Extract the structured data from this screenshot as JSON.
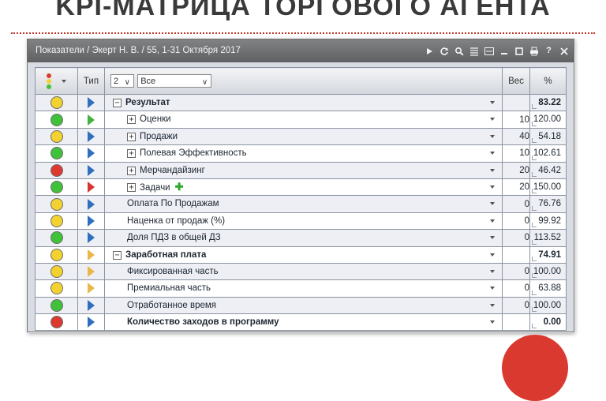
{
  "slide": {
    "title": "KPI-МАТРИЦА ТОРГОВОГО АГЕНТА"
  },
  "window": {
    "title": "Показатели / Экерт Н. В. / 55, 1-31 Октября 2017",
    "toolbar_icons": [
      "play-icon",
      "refresh-icon",
      "search-icon",
      "list-icon",
      "csv-icon",
      "minimize-icon",
      "maximize-icon",
      "print-icon",
      "help-icon",
      "close-icon"
    ]
  },
  "colors": {
    "green": "#3fc23a",
    "yellow": "#f3d22f",
    "red": "#dd3a2f",
    "flag_blue": "#2f6fbf",
    "flag_green": "#3fb33b",
    "flag_red": "#d93434",
    "flag_yellow": "#e8b84a"
  },
  "header": {
    "type_label": "Тип",
    "level_value": "2",
    "filter_value": "Все",
    "weight_label": "Вес",
    "percent_label": "%"
  },
  "rows": [
    {
      "status": "yellow",
      "flag": "blue",
      "expander": "minus",
      "indent": 0,
      "name": "Результат",
      "bold": true,
      "weight": "",
      "percent": "83.22",
      "badge": ""
    },
    {
      "status": "green",
      "flag": "green",
      "expander": "plus",
      "indent": 1,
      "name": "Оценки",
      "bold": false,
      "weight": "10",
      "percent": "120.00",
      "badge": ""
    },
    {
      "status": "yellow",
      "flag": "blue",
      "expander": "plus",
      "indent": 1,
      "name": "Продажи",
      "bold": false,
      "weight": "40",
      "percent": "54.18",
      "badge": ""
    },
    {
      "status": "green",
      "flag": "blue",
      "expander": "plus",
      "indent": 1,
      "name": "Полевая Эффективность",
      "bold": false,
      "weight": "10",
      "percent": "102.61",
      "badge": ""
    },
    {
      "status": "red",
      "flag": "blue",
      "expander": "plus",
      "indent": 1,
      "name": "Мерчандайзинг",
      "bold": false,
      "weight": "20",
      "percent": "46.42",
      "badge": ""
    },
    {
      "status": "green",
      "flag": "red",
      "expander": "plus",
      "indent": 1,
      "name": "Задачи",
      "bold": false,
      "weight": "20",
      "percent": "150.00",
      "badge": "✚"
    },
    {
      "status": "yellow",
      "flag": "blue",
      "expander": "",
      "indent": 1,
      "name": "Оплата По Продажам",
      "bold": false,
      "weight": "0",
      "percent": "76.76",
      "badge": ""
    },
    {
      "status": "yellow",
      "flag": "blue",
      "expander": "",
      "indent": 1,
      "name": "Наценка от продаж (%)",
      "bold": false,
      "weight": "0",
      "percent": "99.92",
      "badge": ""
    },
    {
      "status": "green",
      "flag": "blue",
      "expander": "",
      "indent": 1,
      "name": "Доля ПДЗ в общей ДЗ",
      "bold": false,
      "weight": "0",
      "percent": "113.52",
      "badge": ""
    },
    {
      "status": "yellow",
      "flag": "yellow",
      "expander": "minus",
      "indent": 0,
      "name": "Заработная плата",
      "bold": true,
      "weight": "",
      "percent": "74.91",
      "badge": ""
    },
    {
      "status": "yellow",
      "flag": "yellow",
      "expander": "",
      "indent": 1,
      "name": "Фиксированная часть",
      "bold": false,
      "weight": "0",
      "percent": "100.00",
      "badge": ""
    },
    {
      "status": "yellow",
      "flag": "yellow",
      "expander": "",
      "indent": 1,
      "name": "Премиальная часть",
      "bold": false,
      "weight": "0",
      "percent": "63.88",
      "badge": ""
    },
    {
      "status": "green",
      "flag": "blue",
      "expander": "",
      "indent": 1,
      "name": "Отработанное время",
      "bold": false,
      "weight": "0",
      "percent": "100.00",
      "badge": ""
    },
    {
      "status": "red",
      "flag": "blue",
      "expander": "",
      "indent": 1,
      "name": "Количество заходов в программу",
      "bold": true,
      "weight": "",
      "percent": "0.00",
      "badge": ""
    }
  ]
}
